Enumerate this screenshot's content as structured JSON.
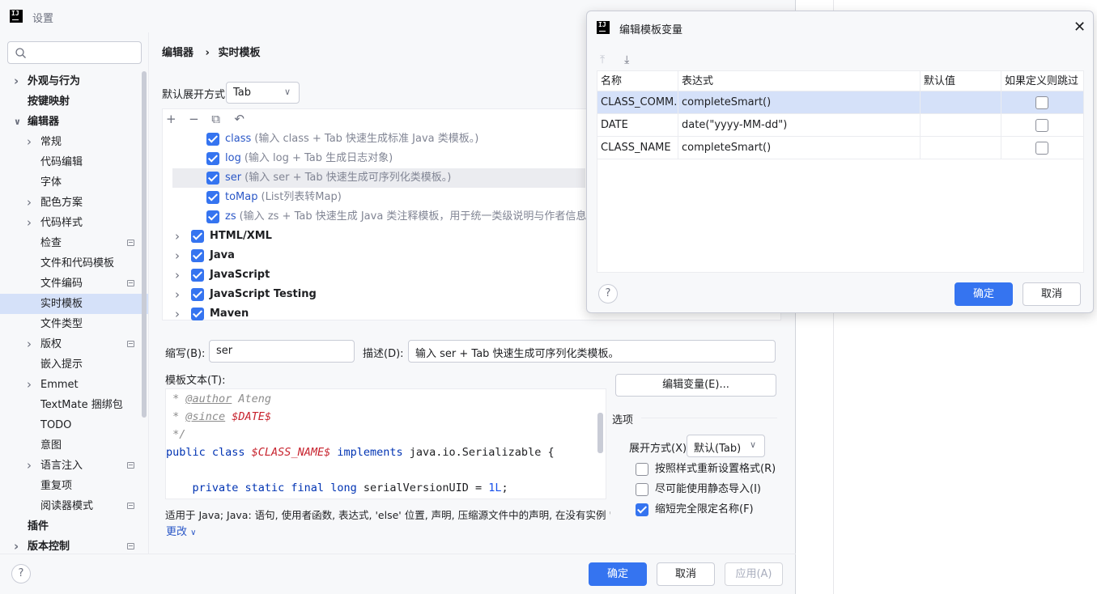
{
  "window": {
    "title": "设置"
  },
  "search": {
    "placeholder": ""
  },
  "sidebar": {
    "items": [
      {
        "label": "外观与行为",
        "level": 0,
        "chevron": "right",
        "bold": true
      },
      {
        "label": "按键映射",
        "level": 0,
        "bold": true
      },
      {
        "label": "编辑器",
        "level": 0,
        "chevron": "down",
        "bold": true
      },
      {
        "label": "常规",
        "level": 1,
        "chevron": "right"
      },
      {
        "label": "代码编辑",
        "level": 1
      },
      {
        "label": "字体",
        "level": 1
      },
      {
        "label": "配色方案",
        "level": 1,
        "chevron": "right"
      },
      {
        "label": "代码样式",
        "level": 1,
        "chevron": "right"
      },
      {
        "label": "检查",
        "level": 1,
        "project": true
      },
      {
        "label": "文件和代码模板",
        "level": 1
      },
      {
        "label": "文件编码",
        "level": 1,
        "project": true
      },
      {
        "label": "实时模板",
        "level": 1,
        "selected": true
      },
      {
        "label": "文件类型",
        "level": 1
      },
      {
        "label": "版权",
        "level": 1,
        "chevron": "right",
        "project": true
      },
      {
        "label": "嵌入提示",
        "level": 1
      },
      {
        "label": "Emmet",
        "level": 1,
        "chevron": "right"
      },
      {
        "label": "TextMate 捆绑包",
        "level": 1
      },
      {
        "label": "TODO",
        "level": 1
      },
      {
        "label": "意图",
        "level": 1
      },
      {
        "label": "语言注入",
        "level": 1,
        "chevron": "right",
        "project": true
      },
      {
        "label": "重复项",
        "level": 1
      },
      {
        "label": "阅读器模式",
        "level": 1,
        "project": true
      },
      {
        "label": "插件",
        "level": 0,
        "bold": true
      },
      {
        "label": "版本控制",
        "level": 0,
        "chevron": "right",
        "bold": true,
        "project": true
      }
    ]
  },
  "breadcrumb": {
    "parent": "编辑器",
    "separator": "›",
    "current": "实时模板"
  },
  "expand": {
    "label": "默认展开方式",
    "value": "Tab"
  },
  "tree_toolbar": [
    "add-icon",
    "remove-icon",
    "copy-icon",
    "revert-icon"
  ],
  "tree": {
    "templates": [
      {
        "name": "class",
        "desc": "(输入 class + Tab 快速生成标准 Java 类模板。)",
        "checked": true
      },
      {
        "name": "log",
        "desc": "(输入 log + Tab 生成日志对象)",
        "checked": true
      },
      {
        "name": "ser",
        "desc": "(输入 ser + Tab 快速生成可序列化类模板。)",
        "checked": true,
        "selected": true
      },
      {
        "name": "toMap",
        "desc": "(List列表转Map)",
        "checked": true
      },
      {
        "name": "zs",
        "desc": "(输入 zs + Tab 快速生成 Java 类注释模板，用于统一类级说明与作者信息。)",
        "checked": true
      }
    ],
    "groups": [
      {
        "name": "HTML/XML",
        "checked": true
      },
      {
        "name": "Java",
        "checked": true
      },
      {
        "name": "JavaScript",
        "checked": true
      },
      {
        "name": "JavaScript Testing",
        "checked": true
      },
      {
        "name": "Maven",
        "checked": true
      }
    ]
  },
  "editor": {
    "abbr_label": "缩写(B):",
    "abbr_value": "ser",
    "desc_label": "描述(D):",
    "desc_value": "输入 ser + Tab 快速生成可序列化类模板。",
    "template_text_label": "模板文本(T):",
    "code": {
      "l1_star": " * ",
      "l1_tag": "@author",
      "l1_val": " Ateng",
      "l2_star": " * ",
      "l2_tag": "@since",
      "l2_var": " $DATE$",
      "l3": " */",
      "l4_kw1": "public class ",
      "l4_var": "$CLASS_NAME$",
      "l4_kw2": " implements ",
      "l4_rest": "java.io.Serializable {",
      "l6_kw": "    private static final long ",
      "l6_name": "serialVersionUID = ",
      "l6_num": "1L",
      "l6_end": ";"
    },
    "applies_to": "适用于 Java; Java: 语句, 使用者函数, 表达式, 'else' 位置, 声明, 压缩源文件中的声明, 在没有实例 'm...",
    "more_link": "更改",
    "edit_vars_button": "编辑变量(E)..."
  },
  "options": {
    "title": "选项",
    "expand_with_label": "展开方式(X)",
    "expand_with_value": "默认(Tab)",
    "checks": [
      {
        "label": "按照样式重新设置格式(R)",
        "checked": false
      },
      {
        "label": "尽可能使用静态导入(I)",
        "checked": false
      },
      {
        "label": "缩短完全限定名称(F)",
        "checked": true
      }
    ]
  },
  "footer": {
    "ok": "确定",
    "cancel": "取消",
    "apply": "应用(A)",
    "help": "?"
  },
  "dialog": {
    "title": "编辑模板变量",
    "close": "✕",
    "toolbar": [
      "move-up-icon",
      "move-down-icon"
    ],
    "columns": [
      "名称",
      "表达式",
      "默认值",
      "如果定义则跳过"
    ],
    "rows": [
      {
        "name": "CLASS_COMM...",
        "expression": "completeSmart()",
        "default": "",
        "skip": false,
        "selected": true
      },
      {
        "name": "DATE",
        "expression": "date(\"yyyy-MM-dd\")",
        "default": "",
        "skip": false
      },
      {
        "name": "CLASS_NAME",
        "expression": "completeSmart()",
        "default": "",
        "skip": false
      }
    ],
    "ok": "确定",
    "cancel": "取消",
    "help": "?"
  },
  "colors": {
    "accent": "#3574f0",
    "selection": "#d5e1f9",
    "link": "#2a57c7"
  }
}
